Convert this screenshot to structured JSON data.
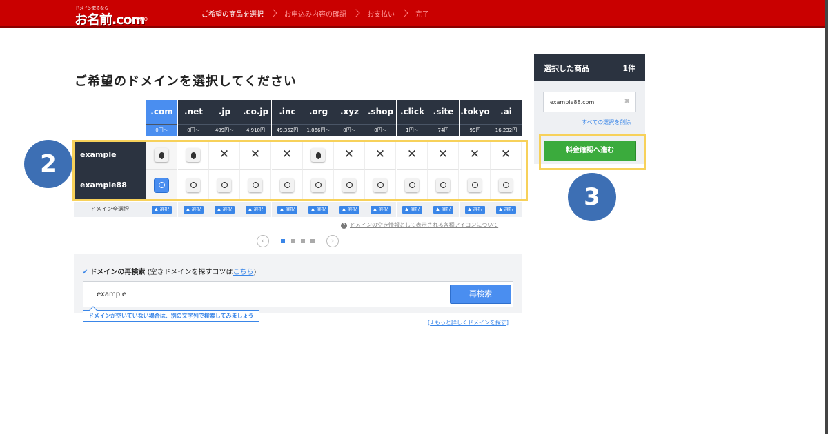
{
  "header": {
    "logo_small": "ドメイン取るなら",
    "logo_main": "お名前.com",
    "logo_brand": "GMO",
    "steps": [
      {
        "label": "ご希望の商品を選択",
        "active": true
      },
      {
        "label": "お申込み内容の確認",
        "active": false
      },
      {
        "label": "お支払い",
        "active": false
      },
      {
        "label": "完了",
        "active": false
      }
    ]
  },
  "page_title": "ご希望のドメインを選択してください",
  "table": {
    "tlds": [
      {
        "name": ".com",
        "price": "0円〜"
      },
      {
        "name": ".net",
        "price": "0円〜"
      },
      {
        "name": ".jp",
        "price": "409円〜"
      },
      {
        "name": ".co.jp",
        "price": "4,910円"
      },
      {
        "name": ".inc",
        "price": "49,352円"
      },
      {
        "name": ".org",
        "price": "1,066円〜"
      },
      {
        "name": ".xyz",
        "price": "0円〜"
      },
      {
        "name": ".shop",
        "price": "0円〜"
      },
      {
        "name": ".click",
        "price": "1円〜"
      },
      {
        "name": ".site",
        "price": "74円"
      },
      {
        "name": ".tokyo",
        "price": "99円"
      },
      {
        "name": ".ai",
        "price": "16,232円"
      }
    ],
    "rows": [
      {
        "label": "example",
        "cells": [
          "bell",
          "bell",
          "x",
          "x",
          "x",
          "bell",
          "x",
          "x",
          "x",
          "x",
          "x",
          "x"
        ]
      },
      {
        "label": "example88",
        "cells": [
          "selected",
          "o",
          "o",
          "o",
          "o",
          "o",
          "o",
          "o",
          "o",
          "o",
          "o",
          "o"
        ]
      }
    ],
    "select_all_label": "ドメイン全選択",
    "select_button_label": "▲ 選択"
  },
  "annotations": {
    "badge_2": "2",
    "badge_3": "3"
  },
  "icon_note": {
    "icon": "question-icon",
    "text": "ドメインの空き情報として表示される各種アイコンについて"
  },
  "pager": {
    "prev": "‹",
    "next": "›",
    "pages": 4,
    "current": 1
  },
  "research": {
    "title": "ドメインの再検索",
    "hint_prefix": "(空きドメインを探すコツは",
    "hint_link": "こちら",
    "hint_suffix": ")",
    "input_value": "example",
    "button_label": "再検索",
    "tooltip": "ドメインが空いていない場合は、別の文字列で検索してみましょう",
    "more_link": "↓もっと詳しくドメインを探す"
  },
  "side_panel": {
    "title": "選択した商品",
    "count": "1件",
    "selected_item": "example88.com",
    "remove_icon": "close-icon",
    "clear_all": "すべての選択を削除",
    "proceed_button": "料金確認へ進む"
  },
  "colors": {
    "header_red": "#c90000",
    "navy": "#2b3340",
    "accent_blue": "#4a8ef0",
    "green": "#3bab3d",
    "highlight_yellow": "#f7d15a",
    "badge_blue": "#3d6fb4"
  }
}
